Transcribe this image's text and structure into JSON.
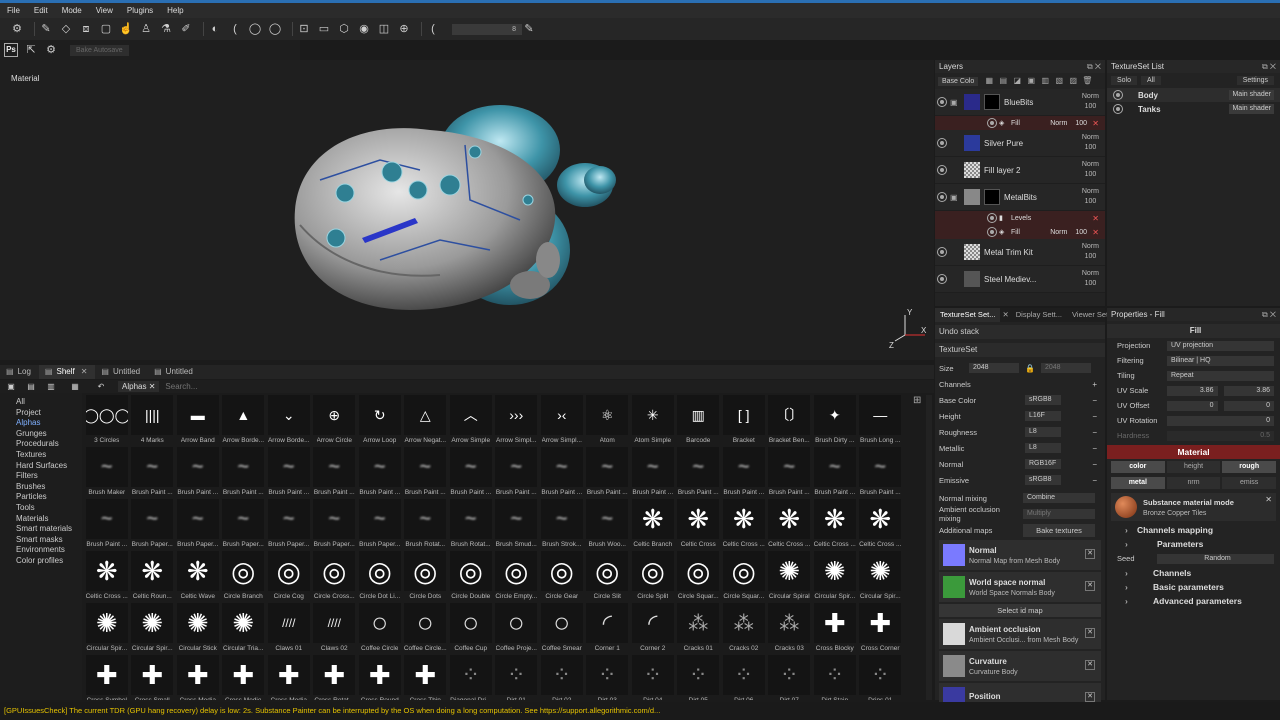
{
  "menu": [
    "File",
    "Edit",
    "Mode",
    "View",
    "Plugins",
    "Help"
  ],
  "toolbar": {
    "size_value": "8",
    "bake_label": "Bake Autosave",
    "ps_label": "Ps"
  },
  "viewport": {
    "label": "Material",
    "gizmo": {
      "y": "Y",
      "x": "X",
      "z": "Z"
    }
  },
  "bottom_tabs": [
    {
      "label": "Log",
      "active": false
    },
    {
      "label": "Shelf",
      "active": true
    },
    {
      "label": "Untitled",
      "active": false
    },
    {
      "label": "Untitled",
      "active": false
    }
  ],
  "shelf": {
    "filter_chip": "Alphas",
    "search_placeholder": "Search...",
    "categories": [
      "All",
      "Project",
      "Alphas",
      "Grunges",
      "Procedurals",
      "Textures",
      "Hard Surfaces",
      "Filters",
      "Brushes",
      "Particles",
      "Tools",
      "Materials",
      "Smart materials",
      "Smart masks",
      "Environments",
      "Color profiles"
    ],
    "active_category": "Alphas",
    "items": [
      "3 Circles",
      "4 Marks",
      "Arrow Band",
      "Arrow Borde...",
      "Arrow Borde...",
      "Arrow Circle",
      "Arrow Loop",
      "Arrow Negat...",
      "Arrow Simple",
      "Arrow Simpl...",
      "Arrow Simpl...",
      "Atom",
      "Atom Simple",
      "Barcode",
      "Bracket",
      "Bracket Ben...",
      "Brush Dirty ...",
      "Brush Long ...",
      "Brush Maker",
      "Brush Paint ...",
      "Brush Paint ...",
      "Brush Paint ...",
      "Brush Paint ...",
      "Brush Paint ...",
      "Brush Paint ...",
      "Brush Paint ...",
      "Brush Paint ...",
      "Brush Paint ...",
      "Brush Paint ...",
      "Brush Paint ...",
      "Brush Paint ...",
      "Brush Paint ...",
      "Brush Paint ...",
      "Brush Paint ...",
      "Brush Paint ...",
      "Brush Paint ...",
      "Brush Paint ...",
      "Brush Paper...",
      "Brush Paper...",
      "Brush Paper...",
      "Brush Paper...",
      "Brush Paper...",
      "Brush Paper...",
      "Brush Rotat...",
      "Brush Rotat...",
      "Brush Smud...",
      "Brush Strok...",
      "Brush Woo...",
      "Celtic Branch",
      "Celtic Cross",
      "Celtic Cross ...",
      "Celtic Cross ...",
      "Celtic Cross ...",
      "Celtic Cross ...",
      "Celtic Cross ...",
      "Celtic Roun...",
      "Celtic Wave",
      "Circle Branch",
      "Circle Cog",
      "Circle Cross...",
      "Circle Dot Li...",
      "Circle Dots",
      "Circle Double",
      "Circle Empty...",
      "Circle Gear",
      "Circle Slit",
      "Circle Split",
      "Circle Squar...",
      "Circle Squar...",
      "Circular Spiral",
      "Circular Spir...",
      "Circular Spir...",
      "Circular Spir...",
      "Circular Spir...",
      "Circular Stick",
      "Circular Tria...",
      "Claws 01",
      "Claws 02",
      "Coffee Circle",
      "Coffee Circle...",
      "Coffee Cup",
      "Coffee Proje...",
      "Coffee Smear",
      "Corner 1",
      "Corner 2",
      "Cracks 01",
      "Cracks 02",
      "Cracks 03",
      "Cross Blocky",
      "Cross Corner",
      "Cross Symbol",
      "Cross Small",
      "Cross Media",
      "Cross Medio",
      "Cross Media",
      "Cross Rotat...",
      "Cross Round",
      "Cross Thin",
      "Diagonal Dri...",
      "Dirt 01",
      "Dirt 02",
      "Dirt 03",
      "Dirt 04",
      "Dirt 05",
      "Dirt 06",
      "Dirt 07",
      "Dirt Stain",
      "Drips 01"
    ]
  },
  "status": "[GPUIssuesCheck] The current TDR (GPU hang recovery) delay is low: 2s. Substance Painter can be interrupted by the OS when doing a long computation. See https://support.allegorithmic.com/d...",
  "layers_panel": {
    "title": "Layers",
    "channel_select": "Base Colo",
    "layers": [
      {
        "name": "BlueBits",
        "blend": "Norm",
        "opacity": "100",
        "thumb": "#2a2a8a",
        "sub": [
          {
            "name": "Fill",
            "blend": "Norm",
            "opacity": "100"
          }
        ]
      },
      {
        "name": "Silver Pure",
        "blend": "Norm",
        "opacity": "100",
        "thumb": "#2b3a9c",
        "sub": []
      },
      {
        "name": "Fill layer 2",
        "blend": "Norm",
        "opacity": "100",
        "thumb": "#bdbdbd",
        "sub": []
      },
      {
        "name": "MetalBits",
        "blend": "Norm",
        "opacity": "100",
        "thumb": "#888888",
        "sub": [
          {
            "name": "Levels",
            "blend": "",
            "opacity": ""
          },
          {
            "name": "Fill",
            "blend": "Norm",
            "opacity": "100"
          }
        ]
      },
      {
        "name": "Metal Trim Kit",
        "blend": "Norm",
        "opacity": "100",
        "thumb": "#bdbdbd",
        "sub": []
      },
      {
        "name": "Steel Mediev...",
        "blend": "Norm",
        "opacity": "100",
        "thumb": "#555555",
        "sub": []
      }
    ]
  },
  "textureset_list": {
    "title": "TextureSet List",
    "buttons": [
      "Solo",
      "All"
    ],
    "settings": "Settings",
    "sets": [
      {
        "name": "Body",
        "shader": "Main shader"
      },
      {
        "name": "Tanks",
        "shader": "Main shader"
      }
    ]
  },
  "ts_settings": {
    "tabs": [
      "TextureSet Set...",
      "Display Sett...",
      "Viewer Sett..."
    ],
    "undo_stack": "Undo stack",
    "textureset": "TextureSet",
    "size_label": "Size",
    "size_value": "2048",
    "size_value2": "2048",
    "channels_label": "Channels",
    "channels": [
      {
        "name": "Base Color",
        "format": "sRGB8"
      },
      {
        "name": "Height",
        "format": "L16F"
      },
      {
        "name": "Roughness",
        "format": "L8"
      },
      {
        "name": "Metallic",
        "format": "L8"
      },
      {
        "name": "Normal",
        "format": "RGB16F"
      },
      {
        "name": "Emissive",
        "format": "sRGB8"
      }
    ],
    "normal_mixing_label": "Normal mixing",
    "normal_mixing": "Combine",
    "ao_mixing_label": "Ambient occlusion mixing",
    "ao_mixing": "Multiply",
    "additional_maps": "Additional maps",
    "bake_textures": "Bake textures",
    "select_id_map": "Select id map",
    "maps": [
      {
        "title": "Normal",
        "sub": "Normal Map from Mesh Body",
        "thumb": "#7a7aff"
      },
      {
        "title": "World space normal",
        "sub": "World Space Normals Body",
        "thumb": "#3b9a3b"
      },
      {
        "title": "Ambient occlusion",
        "sub": "Ambient Occlusi... from Mesh Body",
        "thumb": "#d9d9d9"
      },
      {
        "title": "Curvature",
        "sub": "Curvature Body",
        "thumb": "#8a8a8a"
      },
      {
        "title": "Position",
        "sub": "",
        "thumb": "#3a3aa0"
      }
    ]
  },
  "properties": {
    "title": "Properties - Fill",
    "fill_header": "Fill",
    "projection_label": "Projection",
    "projection": "UV projection",
    "filtering_label": "Filtering",
    "filtering": "Bilinear | HQ",
    "tiling_label": "Tiling",
    "tiling": "Repeat",
    "uv_scale_label": "UV Scale",
    "uv_scale": "3.86",
    "uv_scale2": "3.86",
    "uv_offset_label": "UV Offset",
    "uv_offset": "0",
    "uv_offset2": "0",
    "uv_rotation_label": "UV Rotation",
    "uv_rotation": "0",
    "hardness_label": "Hardness",
    "hardness": "0.5",
    "material_header": "Material",
    "channel_toggles": [
      [
        {
          "label": "color",
          "on": true
        },
        {
          "label": "height",
          "on": false
        },
        {
          "label": "rough",
          "on": true
        }
      ],
      [
        {
          "label": "metal",
          "on": true
        },
        {
          "label": "nrm",
          "on": false
        },
        {
          "label": "emiss",
          "on": false
        }
      ]
    ],
    "substance_mode": "Substance material mode",
    "substance_name": "Bronze Copper Tiles",
    "channels_mapping": "Channels mapping",
    "parameters": "Parameters",
    "seed_label": "Seed",
    "seed_value": "Random",
    "sub_sections": [
      "Channels",
      "Basic parameters",
      "Advanced parameters"
    ]
  },
  "colors": {
    "accent": "#2a6fb4",
    "material_red": "#7a1f1f",
    "status_yellow": "#e6c300",
    "active_blue": "#7fb0ff"
  }
}
